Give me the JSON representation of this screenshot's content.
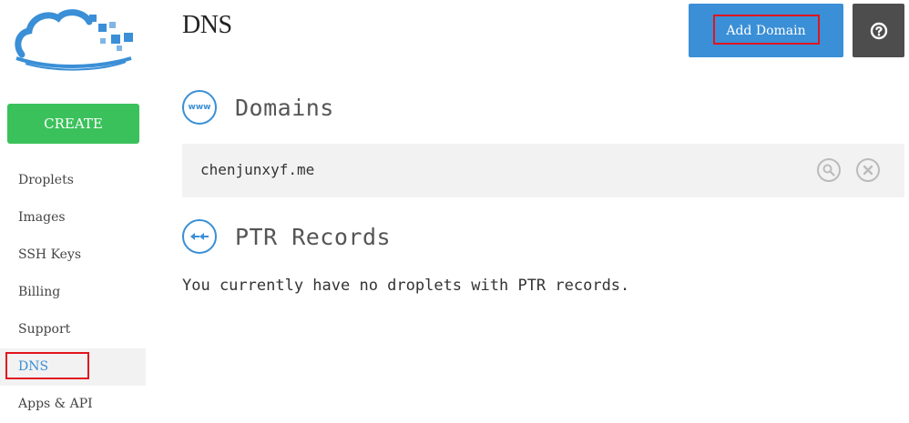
{
  "sidebar": {
    "create_label": "CREATE",
    "items": [
      {
        "label": "Droplets"
      },
      {
        "label": "Images"
      },
      {
        "label": "SSH Keys"
      },
      {
        "label": "Billing"
      },
      {
        "label": "Support"
      },
      {
        "label": "DNS",
        "active": true
      },
      {
        "label": "Apps & API"
      }
    ]
  },
  "header": {
    "title": "DNS",
    "add_domain_label": "Add Domain",
    "help_icon": "question-icon"
  },
  "domains": {
    "title": "Domains",
    "icon_text": "www",
    "rows": [
      {
        "name": "chenjunxyf.me"
      }
    ]
  },
  "ptr": {
    "title": "PTR Records",
    "empty_message": "You currently have no droplets with PTR records."
  },
  "colors": {
    "accent": "#3a8fd6",
    "create": "#3bc15b",
    "help": "#4d4d4d",
    "highlight": "#e0151f",
    "row_bg": "#f2f2f2"
  }
}
